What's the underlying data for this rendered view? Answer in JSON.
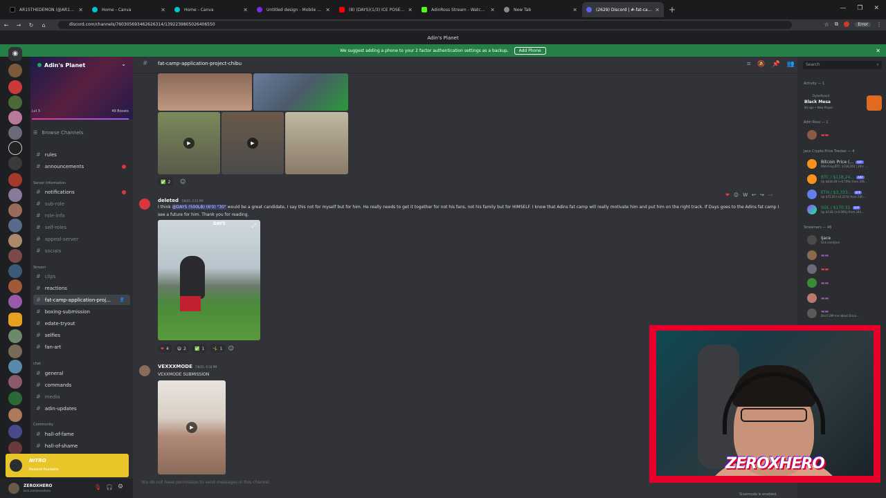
{
  "browser": {
    "tabs": [
      {
        "label": "AR15THEDEMON (@AR15thed...",
        "color": "#000000",
        "active": false
      },
      {
        "label": "Home - Canva",
        "color": "#00c4cc",
        "active": false
      },
      {
        "label": "Home - Canva",
        "color": "#00c4cc",
        "active": false
      },
      {
        "label": "Untitled design - Mobile Video",
        "color": "#7d2ae8",
        "active": false
      },
      {
        "label": "(8) (DAYS)(1/3) ICE POSEIDON",
        "color": "#ff0000",
        "active": false
      },
      {
        "label": "AdinRoss Stream - Watch Live",
        "color": "#53fc18",
        "active": false
      },
      {
        "label": "New Tab",
        "color": "#888888",
        "active": false
      },
      {
        "label": "(2629) Discord | #-fat-camp-ap...",
        "color": "#5865f2",
        "active": true
      }
    ],
    "url": "discord.com/channels/760305693462626314/1392239805026406550",
    "error_label": "Error"
  },
  "discord": {
    "window_title": "Adin's Planet",
    "banner": {
      "text": "We suggest adding a phone to your 2 factor authentication settings as a backup.",
      "button": "Add Phone"
    },
    "server": {
      "name": "Adin's Planet",
      "level": "Lvl 3",
      "boosts": "49 Boosts",
      "browse": "Browse Channels"
    },
    "channels": {
      "rules": "rules",
      "announcements": "announcements",
      "cat_server_info": "Server Information",
      "notifications": "notifications",
      "sub_role": "sub-role",
      "role_info": "role-info",
      "self_roles": "self-roles",
      "appeal_server": "appeal-server",
      "socials": "socials",
      "cat_stream": "Stream",
      "clips": "clips",
      "reactions": "reactions",
      "fat_camp": "fat-camp-application-proj...",
      "boxing": "boxing-submission",
      "edate": "edate-tryout",
      "selfies": "selfies",
      "fan_art": "fan-art",
      "cat_chat": "chat",
      "general": "general",
      "commands": "commands",
      "media": "media",
      "adin_updates": "adin-updates",
      "cat_community": "Community",
      "hall_of_fame": "hall-of-fame",
      "hall_of_shame": "hall-of-shame"
    },
    "nitro": {
      "title": "NITRO",
      "sub": "Reward Available"
    },
    "user": {
      "name": "ZEROXHERO",
      "sub": "kick.com/zeroxhero"
    },
    "channel_header": {
      "name": "fat-camp-application-project-chibu"
    },
    "messages": {
      "m1_react_count": "2",
      "m2_author": "deleted",
      "m2_time": "7/8/25, 2:13 PM",
      "m2_text_pre": "I think ",
      "m2_mention": "@DAYS (500LB) (6'0) \"30\"",
      "m2_text_post": " would be a great candidate, I say this not for myself but for him. He really needs to get it together for not his fans, not his family but for HIMSELF. I know that Adins fat camp will really motivate him and put him on the right track. If Days goes to the Adins fat camp I see a future for him. Thank you for reading.",
      "m2_video_overlay": "DAYS",
      "m2_reactions": [
        "4",
        "2",
        "1",
        "1"
      ],
      "m3_author": "VEXXXMODE",
      "m3_time": "7/8/25, 6:18 PM",
      "m3_text": "VEXXMODE SUBMISSION"
    },
    "no_permission": "You do not have permission to send messages in this channel.",
    "slowmode": "Slowmode is enabled.",
    "members": {
      "search_placeholder": "Search",
      "cat_activity": "Activity — 1",
      "dylan_name": "DylanRyan4",
      "dylan_game": "Black Mesa",
      "dylan_sub": "8d ago • New Player",
      "cat_adin": "Adin Ross — 1",
      "cat_jace": "Jace Crypto Price Tracker — 4",
      "btc_label": "Bitcoin Price (...",
      "btc_sub": "Watching BTC: $118,262 | 24h: ...",
      "btc2_label": "BTC / $118,24...",
      "btc2_sub": "Up $816.49 (+0.70%) from 24h...",
      "eth_label": "ETH / $3,333...",
      "eth_sub": "Up $72.20 (+2.21%) from 24h...",
      "sol_label": "SOL / $170.31",
      "sol_sub": "Up $3.81 (+4.00%) from 24h...",
      "app_tag": "APP",
      "cat_streamers": "Streamers — 46",
      "jace": "Ijace",
      "jace_sub": "kick.com/jace",
      "wcrp_sub": "Don't DM me about Disco..."
    },
    "stream_overlay": {
      "logo": "ZEROXHERO"
    }
  }
}
